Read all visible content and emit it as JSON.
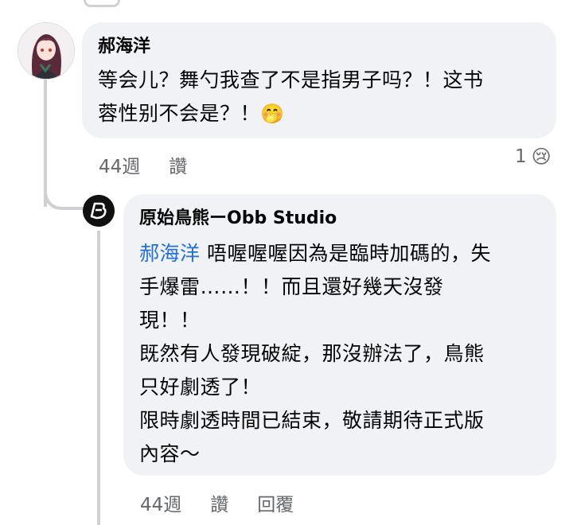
{
  "comment": {
    "author": "郝海洋",
    "lines": [
      "等会儿？舞勺我查了不是指男子吗？！这书",
      "蓉性别不会是？！"
    ],
    "emoji": "🤭",
    "time": "44週",
    "like_label": "讚",
    "reaction_count": "1",
    "reaction_emoji": "😢"
  },
  "reply": {
    "author": "原始鳥熊ーObb Studio",
    "mention": "郝海洋",
    "first_line_rest": " 唔喔喔喔因為是臨時加碼的，失",
    "lines": [
      "手爆雷……！！而且還好幾天沒發",
      "現！！",
      "既然有人發現破綻，那沒辦法了，鳥熊",
      "只好劇透了！",
      "限時劇透時間已結束，敬請期待正式版",
      "內容～"
    ],
    "time": "44週",
    "like_label": "讚",
    "reply_label": "回覆"
  },
  "colors": {
    "bubble": "#f0f2f5",
    "meta": "#65676b",
    "mention": "#216fdb",
    "thread_line": "#ced0d4"
  }
}
